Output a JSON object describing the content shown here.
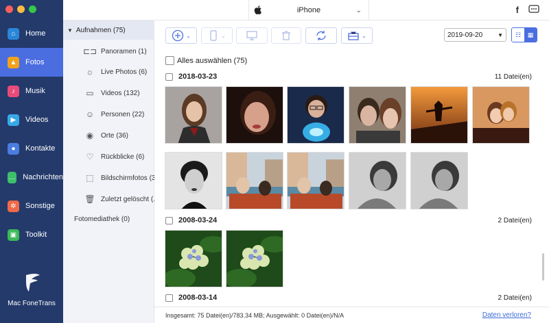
{
  "window": {
    "controls": [
      "close",
      "minimize",
      "zoom"
    ]
  },
  "nav": {
    "items": [
      {
        "label": "Home",
        "icon": "home-icon",
        "color": "#2a86d8",
        "glyph": "⌂"
      },
      {
        "label": "Fotos",
        "icon": "photos-icon",
        "color": "#f3a21e",
        "glyph": "▲",
        "active": true
      },
      {
        "label": "Musik",
        "icon": "music-icon",
        "color": "#e84b7a",
        "glyph": "♪"
      },
      {
        "label": "Videos",
        "icon": "video-icon",
        "color": "#38a9e8",
        "glyph": "▶"
      },
      {
        "label": "Kontakte",
        "icon": "contacts-icon",
        "color": "#4b7de0",
        "glyph": "●"
      },
      {
        "label": "Nachrichten",
        "icon": "messages-icon",
        "color": "#3cc06a",
        "glyph": "…"
      },
      {
        "label": "Sonstige",
        "icon": "other-icon",
        "color": "#ee6a4a",
        "glyph": "✲"
      },
      {
        "label": "Toolkit",
        "icon": "toolkit-icon",
        "color": "#3cb858",
        "glyph": "▣"
      }
    ],
    "brand": "Mac FoneTrans"
  },
  "topbar": {
    "device": "iPhone"
  },
  "tree": {
    "root": "Aufnahmen (75)",
    "items": [
      {
        "label": "Panoramen (1)",
        "icon": "panorama-icon",
        "glyph": "⊏⊐"
      },
      {
        "label": "Live Photos (6)",
        "icon": "live-photo-icon",
        "glyph": "☼"
      },
      {
        "label": "Videos (132)",
        "icon": "video-camera-icon",
        "glyph": "▭"
      },
      {
        "label": "Personen (22)",
        "icon": "person-icon",
        "glyph": "☺"
      },
      {
        "label": "Orte (36)",
        "icon": "location-icon",
        "glyph": "◉"
      },
      {
        "label": "Rückblicke (6)",
        "icon": "memories-icon",
        "glyph": "♡"
      },
      {
        "label": "Bildschirmfotos (3)",
        "icon": "screenshot-icon",
        "glyph": "⬚"
      },
      {
        "label": "Zuletzt gelöscht (...",
        "icon": "trash-icon",
        "glyph": "🗑"
      }
    ],
    "library": "Fotomediathek (0)"
  },
  "toolbar": {
    "date": "2019-09-20"
  },
  "main": {
    "select_all": "Alles auswählen (75)",
    "groups": [
      {
        "date": "2018-03-23",
        "count": "11 Datei(en)"
      },
      {
        "date": "2008-03-24",
        "count": "2 Datei(en)"
      },
      {
        "date": "2008-03-14",
        "count": "2 Datei(en)"
      }
    ]
  },
  "status": {
    "text": "Insgesamt: 75 Datei(en)/783.34 MB; Ausgewählt: 0 Datei(en)/N/A",
    "link": "Daten verloren?"
  }
}
